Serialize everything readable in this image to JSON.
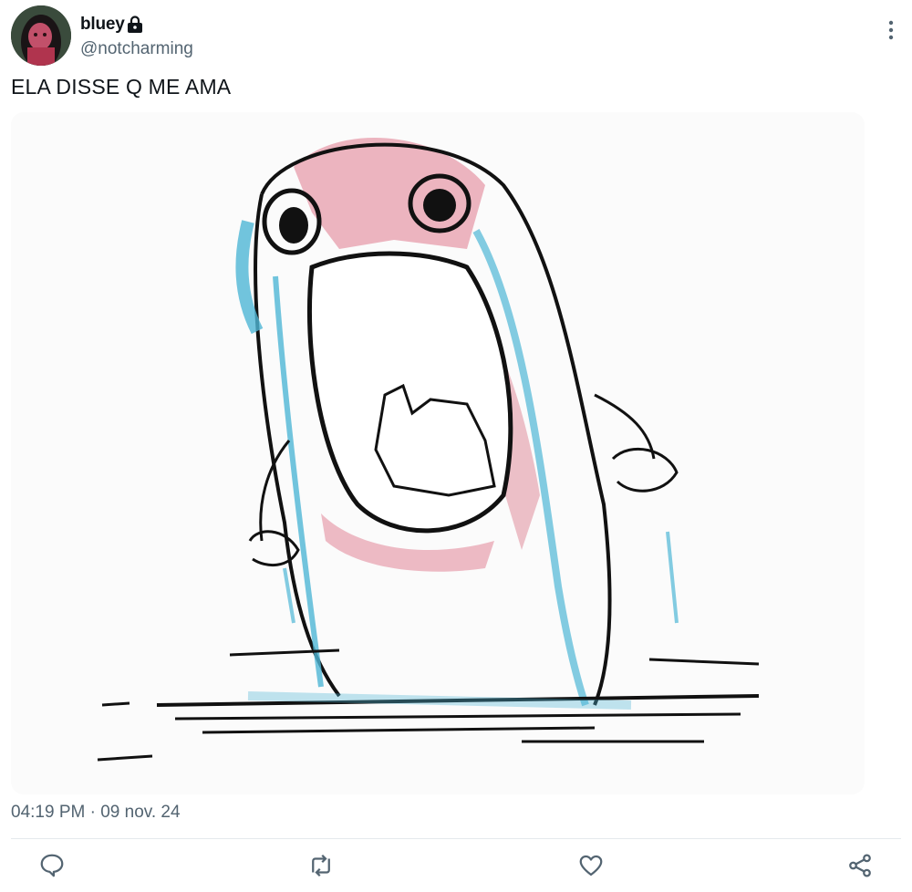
{
  "tweet": {
    "display_name": "bluey",
    "handle": "@notcharming",
    "text": "ELA DISSE Q ME AMA",
    "timestamp": "04:19 PM · 09 nov. 24",
    "verified_lock_icon": "lock-icon",
    "media_subject": "crying-creature-drawing"
  },
  "actions": {
    "icons": [
      "reply-icon",
      "retweet-icon",
      "like-icon",
      "share-icon"
    ]
  },
  "colors": {
    "muted_text": "#536471",
    "divider": "#e5e9ec",
    "tear_blue": "#4fb6d6",
    "cheek_pink": "#e07a8e"
  }
}
